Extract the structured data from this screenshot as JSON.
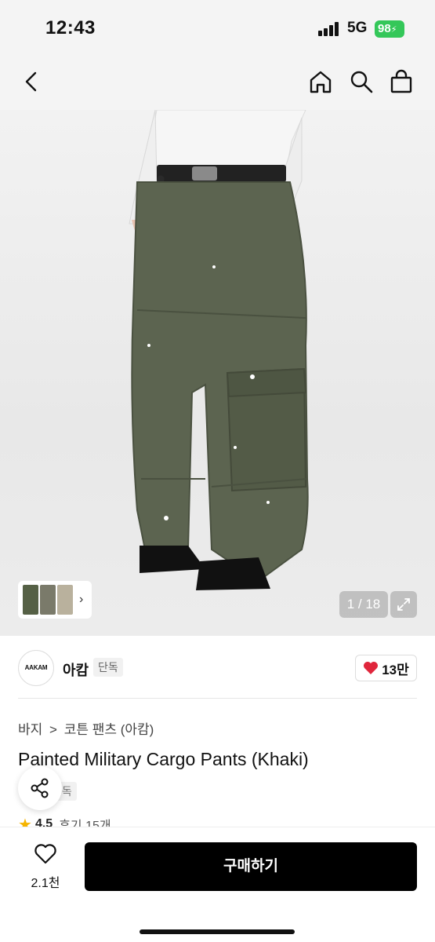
{
  "status_bar": {
    "time": "12:43",
    "network": "5G",
    "battery": "98"
  },
  "nav": {
    "back_icon": "chevron-left-icon",
    "home_icon": "home-icon",
    "search_icon": "search-icon",
    "bag_icon": "shopping-bag-icon"
  },
  "gallery": {
    "counter": "1 / 18",
    "expand_icon": "expand-icon",
    "thumb_colors": [
      "#556045",
      "#7a7a6a",
      "#b9b19d"
    ]
  },
  "brand": {
    "logo_text": "AAKAM",
    "name": "아캄",
    "badge": "단독",
    "like_count": "13만",
    "like_color": "#e0263c"
  },
  "product": {
    "breadcrumb": [
      "바지",
      "코튼 팬츠 (아캄)"
    ],
    "breadcrumb_separator": ">",
    "title": "Painted Military Cargo Pants (Khaki)",
    "exclusive_badge": "단독",
    "rating": "4.5",
    "review_label": "후기 15개"
  },
  "bottom": {
    "wish_count": "2.1천",
    "buy_label": "구매하기"
  },
  "colors": {
    "accent_black": "#000000",
    "star": "#f5b400"
  }
}
